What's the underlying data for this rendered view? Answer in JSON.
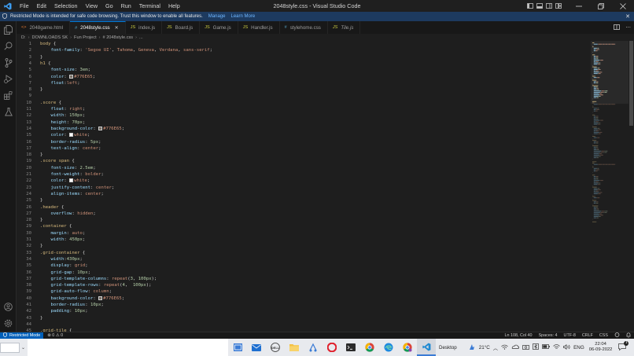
{
  "window": {
    "title": "2048style.css - Visual Studio Code",
    "menu": [
      "File",
      "Edit",
      "Selection",
      "View",
      "Go",
      "Run",
      "Terminal",
      "Help"
    ]
  },
  "banner": {
    "message": "Restricted Mode is intended for safe code browsing. Trust this window to enable all features.",
    "manage": "Manage",
    "learn_more": "Learn More"
  },
  "tabs": [
    {
      "label": "2048game.html",
      "icon": "<>",
      "color": "#e37933"
    },
    {
      "label": "2048style.css",
      "icon": "#",
      "color": "#519aba",
      "active": true
    },
    {
      "label": "index.js",
      "icon": "JS",
      "color": "#cbcb41"
    },
    {
      "label": "Board.js",
      "icon": "JS",
      "color": "#cbcb41"
    },
    {
      "label": "Game.js",
      "icon": "JS",
      "color": "#cbcb41"
    },
    {
      "label": "Handler.js",
      "icon": "JS",
      "color": "#cbcb41"
    },
    {
      "label": "stylehome.css",
      "icon": "#",
      "color": "#519aba"
    },
    {
      "label": "Tile.js",
      "icon": "JS",
      "color": "#cbcb41",
      "italic": true
    }
  ],
  "breadcrumb": [
    "D:",
    "DOWNLOADS SK",
    "Fun Project",
    "# 2048style.css",
    "..."
  ],
  "code": [
    {
      "n": "1",
      "t": [
        [
          "sel",
          "body "
        ],
        [
          "punc",
          "{"
        ]
      ]
    },
    {
      "n": "2",
      "t": [
        [
          "punc",
          "    "
        ],
        [
          "prop",
          "font-family"
        ],
        [
          "punc",
          ": "
        ],
        [
          "val",
          "'Segoe UI'"
        ],
        [
          "punc",
          ", "
        ],
        [
          "val",
          "Tahoma"
        ],
        [
          "punc",
          ", "
        ],
        [
          "val",
          "Geneva"
        ],
        [
          "punc",
          ", "
        ],
        [
          "val",
          "Verdana"
        ],
        [
          "punc",
          ", "
        ],
        [
          "val",
          "sans-serif"
        ],
        [
          "punc",
          ";"
        ]
      ]
    },
    {
      "n": "3",
      "t": [
        [
          "punc",
          "}"
        ]
      ]
    },
    {
      "n": "4",
      "t": [
        [
          "sel",
          "h1 "
        ],
        [
          "punc",
          "{"
        ]
      ]
    },
    {
      "n": "5",
      "t": [
        [
          "punc",
          "    "
        ],
        [
          "prop",
          "font-size"
        ],
        [
          "punc",
          ": "
        ],
        [
          "num",
          "3em"
        ],
        [
          "punc",
          ";"
        ]
      ]
    },
    {
      "n": "6",
      "t": [
        [
          "punc",
          "    "
        ],
        [
          "prop",
          "color"
        ],
        [
          "punc",
          ": "
        ],
        [
          "swatch",
          "#776E65"
        ],
        [
          "val",
          "#776E65"
        ],
        [
          "punc",
          ";"
        ]
      ]
    },
    {
      "n": "7",
      "t": [
        [
          "punc",
          "    "
        ],
        [
          "prop",
          "float"
        ],
        [
          "punc",
          ":"
        ],
        [
          "val",
          "left"
        ],
        [
          "punc",
          ";"
        ]
      ]
    },
    {
      "n": "8",
      "t": [
        [
          "punc",
          "}"
        ]
      ]
    },
    {
      "n": "9",
      "t": []
    },
    {
      "n": "10",
      "t": [
        [
          "sel",
          ".score "
        ],
        [
          "punc",
          "{"
        ]
      ]
    },
    {
      "n": "11",
      "t": [
        [
          "punc",
          "    "
        ],
        [
          "prop",
          "float"
        ],
        [
          "punc",
          ": "
        ],
        [
          "val",
          "right"
        ],
        [
          "punc",
          ";"
        ]
      ]
    },
    {
      "n": "12",
      "t": [
        [
          "punc",
          "    "
        ],
        [
          "prop",
          "width"
        ],
        [
          "punc",
          ": "
        ],
        [
          "num",
          "150px"
        ],
        [
          "punc",
          ";"
        ]
      ]
    },
    {
      "n": "13",
      "t": [
        [
          "punc",
          "    "
        ],
        [
          "prop",
          "height"
        ],
        [
          "punc",
          ": "
        ],
        [
          "num",
          "70px"
        ],
        [
          "punc",
          ";"
        ]
      ]
    },
    {
      "n": "14",
      "t": [
        [
          "punc",
          "    "
        ],
        [
          "prop",
          "background-color"
        ],
        [
          "punc",
          ": "
        ],
        [
          "swatch",
          "#776E65"
        ],
        [
          "val",
          "#776E65"
        ],
        [
          "punc",
          ";"
        ]
      ]
    },
    {
      "n": "15",
      "t": [
        [
          "punc",
          "    "
        ],
        [
          "prop",
          "color"
        ],
        [
          "punc",
          ": "
        ],
        [
          "swatch",
          "#ffffff"
        ],
        [
          "val",
          "white"
        ],
        [
          "punc",
          ";"
        ]
      ]
    },
    {
      "n": "16",
      "t": [
        [
          "punc",
          "    "
        ],
        [
          "prop",
          "border-radius"
        ],
        [
          "punc",
          ": "
        ],
        [
          "num",
          "5px"
        ],
        [
          "punc",
          ";"
        ]
      ]
    },
    {
      "n": "17",
      "t": [
        [
          "punc",
          "    "
        ],
        [
          "prop",
          "text-align"
        ],
        [
          "punc",
          ": "
        ],
        [
          "val",
          "center"
        ],
        [
          "punc",
          ";"
        ]
      ]
    },
    {
      "n": "18",
      "t": [
        [
          "punc",
          "}"
        ]
      ]
    },
    {
      "n": "19",
      "t": [
        [
          "sel",
          ".score span "
        ],
        [
          "punc",
          "{"
        ]
      ]
    },
    {
      "n": "20",
      "t": [
        [
          "punc",
          "    "
        ],
        [
          "prop",
          "font-size"
        ],
        [
          "punc",
          ": "
        ],
        [
          "num",
          "2.5em"
        ],
        [
          "punc",
          ";"
        ]
      ]
    },
    {
      "n": "21",
      "t": [
        [
          "punc",
          "    "
        ],
        [
          "prop",
          "font-weight"
        ],
        [
          "punc",
          ": "
        ],
        [
          "val",
          "bolder"
        ],
        [
          "punc",
          ";"
        ]
      ]
    },
    {
      "n": "22",
      "t": [
        [
          "punc",
          "    "
        ],
        [
          "prop",
          "color"
        ],
        [
          "punc",
          ": "
        ],
        [
          "swatch",
          "#ffffff"
        ],
        [
          "val",
          "white"
        ],
        [
          "punc",
          ";"
        ]
      ]
    },
    {
      "n": "23",
      "t": [
        [
          "punc",
          "    "
        ],
        [
          "prop",
          "justify-content"
        ],
        [
          "punc",
          ": "
        ],
        [
          "val",
          "center"
        ],
        [
          "punc",
          ";"
        ]
      ]
    },
    {
      "n": "24",
      "t": [
        [
          "punc",
          "    "
        ],
        [
          "prop",
          "align-items"
        ],
        [
          "punc",
          ": "
        ],
        [
          "val",
          "center"
        ],
        [
          "punc",
          ";"
        ]
      ]
    },
    {
      "n": "25",
      "t": [
        [
          "punc",
          "}"
        ]
      ]
    },
    {
      "n": "26",
      "t": [
        [
          "sel",
          ".header "
        ],
        [
          "punc",
          "{"
        ]
      ]
    },
    {
      "n": "27",
      "t": [
        [
          "punc",
          "    "
        ],
        [
          "prop",
          "overflow"
        ],
        [
          "punc",
          ": "
        ],
        [
          "val",
          "hidden"
        ],
        [
          "punc",
          ";"
        ]
      ]
    },
    {
      "n": "28",
      "t": [
        [
          "punc",
          "}"
        ]
      ]
    },
    {
      "n": "29",
      "t": [
        [
          "sel",
          ".container "
        ],
        [
          "punc",
          "{"
        ]
      ]
    },
    {
      "n": "30",
      "t": [
        [
          "punc",
          "    "
        ],
        [
          "prop",
          "margin"
        ],
        [
          "punc",
          ": "
        ],
        [
          "val",
          "auto"
        ],
        [
          "punc",
          ";"
        ]
      ]
    },
    {
      "n": "31",
      "t": [
        [
          "punc",
          "    "
        ],
        [
          "prop",
          "width"
        ],
        [
          "punc",
          ": "
        ],
        [
          "num",
          "450px"
        ],
        [
          "punc",
          ";"
        ]
      ]
    },
    {
      "n": "32",
      "t": [
        [
          "punc",
          "}"
        ]
      ]
    },
    {
      "n": "33",
      "t": [
        [
          "sel",
          ".grid-container "
        ],
        [
          "punc",
          "{"
        ]
      ]
    },
    {
      "n": "34",
      "t": [
        [
          "punc",
          "    "
        ],
        [
          "prop",
          "width"
        ],
        [
          "punc",
          ":"
        ],
        [
          "num",
          "430px"
        ],
        [
          "punc",
          ";"
        ]
      ]
    },
    {
      "n": "35",
      "t": [
        [
          "punc",
          "    "
        ],
        [
          "prop",
          "display"
        ],
        [
          "punc",
          ": "
        ],
        [
          "val",
          "grid"
        ],
        [
          "punc",
          ";"
        ]
      ]
    },
    {
      "n": "36",
      "t": [
        [
          "punc",
          "    "
        ],
        [
          "prop",
          "grid-gap"
        ],
        [
          "punc",
          ": "
        ],
        [
          "num",
          "10px"
        ],
        [
          "punc",
          ";"
        ]
      ]
    },
    {
      "n": "37",
      "t": [
        [
          "punc",
          "    "
        ],
        [
          "prop",
          "grid-template-columns"
        ],
        [
          "punc",
          ": "
        ],
        [
          "val",
          "repeat"
        ],
        [
          "punc",
          "("
        ],
        [
          "num",
          "3"
        ],
        [
          "punc",
          ", "
        ],
        [
          "num",
          "100px"
        ],
        [
          "punc",
          ");"
        ]
      ]
    },
    {
      "n": "38",
      "t": [
        [
          "punc",
          "    "
        ],
        [
          "prop",
          "grid-template-rows"
        ],
        [
          "punc",
          ": "
        ],
        [
          "val",
          "repeat"
        ],
        [
          "punc",
          "("
        ],
        [
          "num",
          "4"
        ],
        [
          "punc",
          ",  "
        ],
        [
          "num",
          "100px"
        ],
        [
          "punc",
          ");"
        ]
      ]
    },
    {
      "n": "39",
      "t": [
        [
          "punc",
          "    "
        ],
        [
          "prop",
          "grid-auto-flow"
        ],
        [
          "punc",
          ": "
        ],
        [
          "val",
          "column"
        ],
        [
          "punc",
          ";"
        ]
      ]
    },
    {
      "n": "40",
      "t": [
        [
          "punc",
          "    "
        ],
        [
          "prop",
          "background-color"
        ],
        [
          "punc",
          ": "
        ],
        [
          "swatch",
          "#776E65"
        ],
        [
          "val",
          "#776E65"
        ],
        [
          "punc",
          ";"
        ]
      ]
    },
    {
      "n": "41",
      "t": [
        [
          "punc",
          "    "
        ],
        [
          "prop",
          "border-radius"
        ],
        [
          "punc",
          ": "
        ],
        [
          "num",
          "10px"
        ],
        [
          "punc",
          ";"
        ]
      ]
    },
    {
      "n": "42",
      "t": [
        [
          "punc",
          "    "
        ],
        [
          "prop",
          "padding"
        ],
        [
          "punc",
          ": "
        ],
        [
          "num",
          "10px"
        ],
        [
          "punc",
          ";"
        ]
      ]
    },
    {
      "n": "43",
      "t": [
        [
          "punc",
          "}"
        ]
      ]
    },
    {
      "n": "44",
      "t": []
    },
    {
      "n": "45",
      "t": [
        [
          "sel",
          ".grid-tile "
        ],
        [
          "punc",
          "{"
        ]
      ]
    }
  ],
  "status": {
    "restricted": "Restricted Mode",
    "problems": "⊗ 0 ⚠ 0",
    "position": "Ln 108, Col 40",
    "spaces": "Spaces: 4",
    "encoding": "UTF-8",
    "eol": "CRLF",
    "language": "CSS"
  },
  "taskbar": {
    "desktop_label": "Desktop",
    "temperature": "21°C",
    "lang": "ENG",
    "time": "22:04",
    "date": "06-09-2022",
    "notification_count": "1"
  },
  "colors": {
    "accent": "#0078d4",
    "banner": "#1d3a5f",
    "editor_bg": "#1e1e1e"
  }
}
